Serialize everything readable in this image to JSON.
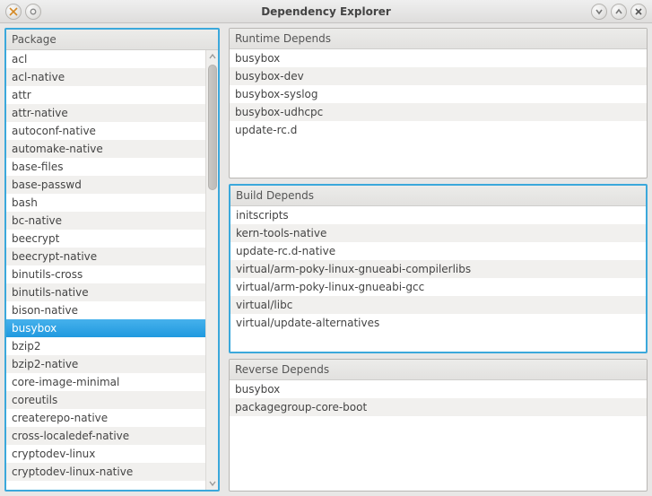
{
  "window": {
    "title": "Dependency Explorer"
  },
  "left": {
    "header": "Package",
    "selected": "busybox",
    "items": [
      "acl",
      "acl-native",
      "attr",
      "attr-native",
      "autoconf-native",
      "automake-native",
      "base-files",
      "base-passwd",
      "bash",
      "bc-native",
      "beecrypt",
      "beecrypt-native",
      "binutils-cross",
      "binutils-native",
      "bison-native",
      "busybox",
      "bzip2",
      "bzip2-native",
      "core-image-minimal",
      "coreutils",
      "createrepo-native",
      "cross-localedef-native",
      "cryptodev-linux",
      "cryptodev-linux-native"
    ]
  },
  "runtime": {
    "header": "Runtime Depends",
    "items": [
      "busybox",
      "busybox-dev",
      "busybox-syslog",
      "busybox-udhcpc",
      "update-rc.d"
    ]
  },
  "build": {
    "header": "Build Depends",
    "items": [
      "initscripts",
      "kern-tools-native",
      "update-rc.d-native",
      "virtual/arm-poky-linux-gnueabi-compilerlibs",
      "virtual/arm-poky-linux-gnueabi-gcc",
      "virtual/libc",
      "virtual/update-alternatives"
    ]
  },
  "reverse": {
    "header": "Reverse Depends",
    "items": [
      "busybox",
      "packagegroup-core-boot"
    ]
  }
}
